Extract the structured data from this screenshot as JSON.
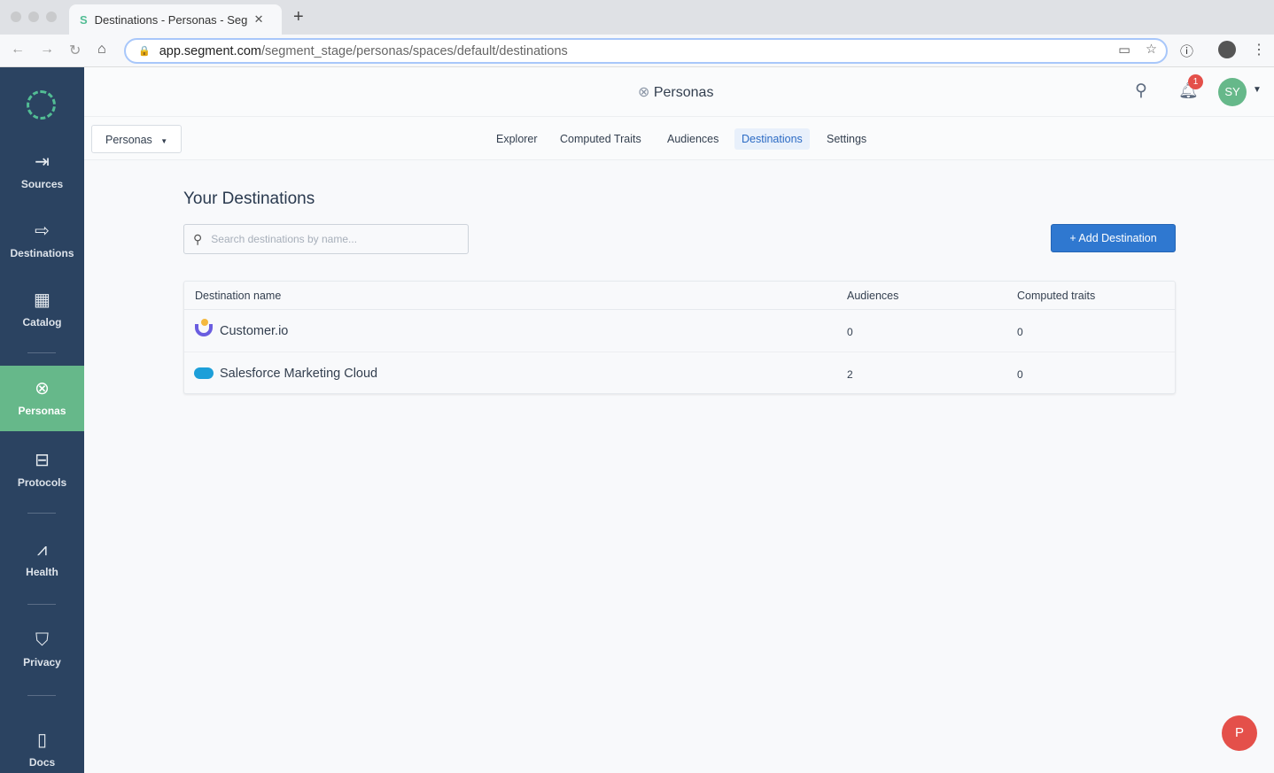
{
  "browser": {
    "tab_title": "Destinations - Personas - Segment",
    "url_host": "app.segment.com",
    "url_path": "/segment_stage/personas/spaces/default/destinations"
  },
  "sidebar": {
    "items": [
      {
        "label": "Sources",
        "icon": "sources-icon"
      },
      {
        "label": "Destinations",
        "icon": "destinations-icon"
      },
      {
        "label": "Catalog",
        "icon": "catalog-icon"
      },
      {
        "label": "Personas",
        "icon": "personas-icon",
        "active": true
      },
      {
        "label": "Protocols",
        "icon": "protocols-icon"
      },
      {
        "label": "Health",
        "icon": "health-icon"
      },
      {
        "label": "Privacy",
        "icon": "privacy-icon"
      },
      {
        "label": "Docs",
        "icon": "docs-icon"
      }
    ]
  },
  "header": {
    "title": "Personas",
    "notification_count": "1",
    "avatar_initials": "SY"
  },
  "subnav": {
    "space_selector": "Personas",
    "tabs": [
      "Explorer",
      "Computed Traits",
      "Audiences",
      "Destinations",
      "Settings"
    ],
    "active": "Destinations"
  },
  "main": {
    "title": "Your Destinations",
    "search_placeholder": "Search destinations by name...",
    "add_button": "+ Add Destination",
    "columns": [
      "Destination name",
      "Audiences",
      "Computed traits"
    ],
    "rows": [
      {
        "name": "Customer.io",
        "audiences": "0",
        "computed_traits": "0"
      },
      {
        "name": "Salesforce Marketing Cloud",
        "audiences": "2",
        "computed_traits": "0"
      }
    ]
  },
  "help_bubble": "P",
  "colors": {
    "sidebar": "#2b4361",
    "active": "#66b88a",
    "primary": "#2f78d0",
    "badge": "#e4504a"
  }
}
